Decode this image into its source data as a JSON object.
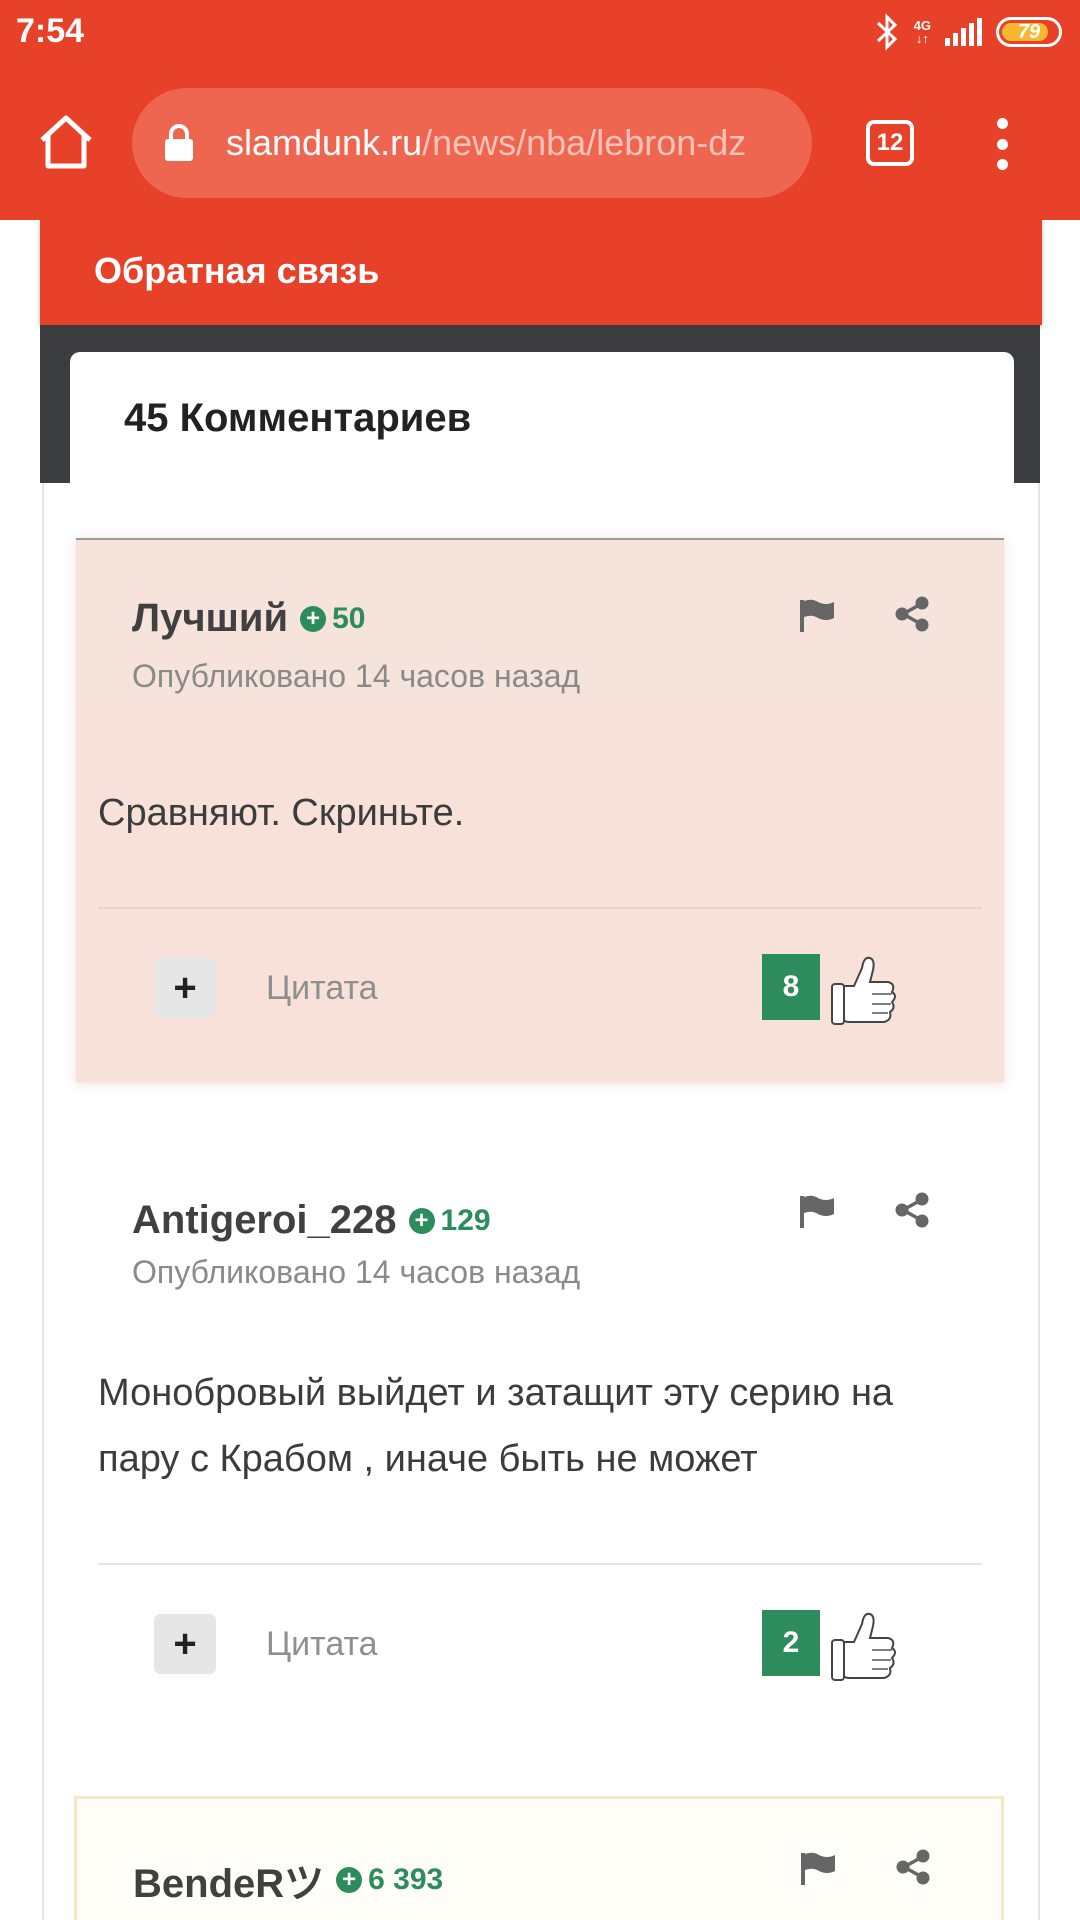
{
  "status_bar": {
    "time": "7:54",
    "network": "4G",
    "battery": "79",
    "icons": [
      "bluetooth-icon",
      "signal-icon",
      "battery-icon"
    ]
  },
  "browser": {
    "url_domain": "slamdunk.ru",
    "url_path": "/news/nba/lebron-dz",
    "tab_count": "12",
    "icons": [
      "home-icon",
      "lock-icon",
      "tabs-icon",
      "more-icon"
    ]
  },
  "page": {
    "feedback_label": "Обратная связь",
    "comments_title": "45 Комментариев"
  },
  "comments": [
    {
      "author": "Лучший",
      "rating": "50",
      "published": "Опубликовано 14 часов назад",
      "text": "Сравняют. Скриньте.",
      "quote_label": "Цитата",
      "plus_label": "+",
      "likes": "8"
    },
    {
      "author": "Antigeroi_228",
      "rating": "129",
      "published": "Опубликовано 14 часов назад",
      "text": "Монобровый выйдет и затащит эту серию на пару с Крабом , иначе быть не может",
      "quote_label": "Цитата",
      "plus_label": "+",
      "likes": "2"
    },
    {
      "author": "BendeRツ",
      "rating": "6 393"
    }
  ],
  "colors": {
    "brand_red": "#e8412a",
    "rating_green": "#2c8c5c",
    "best_comment_bg": "#f7e1d8"
  }
}
